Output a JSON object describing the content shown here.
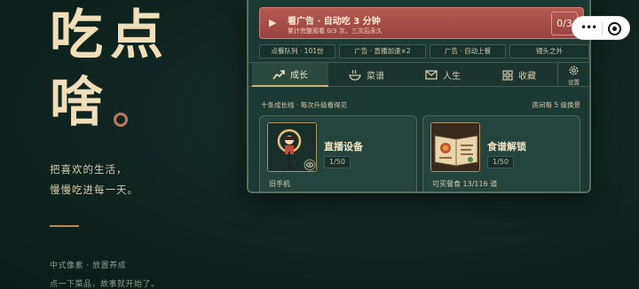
{
  "hero": {
    "title_line1": "吃点",
    "title_line2": "啥",
    "tagline_line1": "把喜欢的生活，",
    "tagline_line2": "慢慢吃进每一天。",
    "footer_line1": "中式像素 · 放置养成",
    "footer_line2": "点一下菜品，故事就开始了。"
  },
  "ad_banner": {
    "title": "看广告 · 自动吃 3 分钟",
    "subtitle": "累计完整观看 0/3 次，三次后永久",
    "counter": "0/3",
    "play_icon": "play-icon"
  },
  "chips": [
    {
      "label": "点餐队列 · 101份"
    },
    {
      "label": "广告 · 直播加速×2"
    },
    {
      "label": "广告 · 自动上餐"
    },
    {
      "label": "镜头之外"
    }
  ],
  "tabs": [
    {
      "label": "成长",
      "icon": "trend-up-icon",
      "active": true
    },
    {
      "label": "菜谱",
      "icon": "bowl-icon",
      "active": false
    },
    {
      "label": "人生",
      "icon": "mail-icon",
      "active": false
    },
    {
      "label": "收藏",
      "icon": "grid-icon",
      "active": false
    }
  ],
  "settings": {
    "label": "设置",
    "icon": "gear-icon"
  },
  "info": {
    "left": "十条成长线 · 每次升级看得见",
    "right": "房间每 5 级换景"
  },
  "cards": [
    {
      "name": "直播设备",
      "level": "1/50",
      "sub": "旧手机",
      "icon": "ring-light-icon"
    },
    {
      "name": "食谱解锁",
      "level": "1/50",
      "sub": "可买餐食 13/116 道",
      "icon": "recipe-book-icon"
    }
  ],
  "colors": {
    "background": "#0f2420",
    "panel": "#1c3a34",
    "ad_red": "#b55a53",
    "accent_gold": "#c9b17a",
    "hero_text": "#eedfb8"
  }
}
